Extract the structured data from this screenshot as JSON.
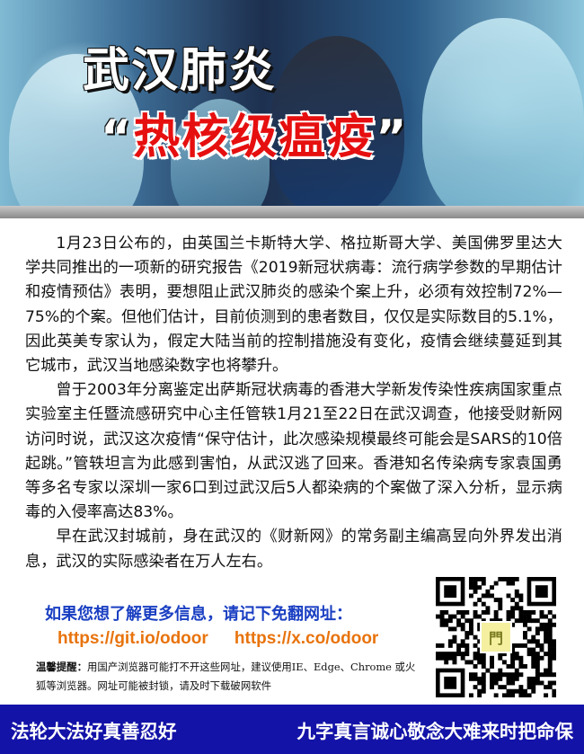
{
  "hero": {
    "title": "武汉肺炎",
    "subtitle_quote_open": "“",
    "subtitle": "热核级瘟疫",
    "subtitle_quote_close": "”"
  },
  "article": {
    "paragraphs": [
      "1月23日公布的，由英国兰卡斯特大学、格拉斯哥大学、美国佛罗里达大学共同推出的一项新的研究报告《2019新冠状病毒：流行病学参数的早期估计和疫情预估》表明，要想阻止武汉肺炎的感染个案上升，必须有效控制72%—75%的个案。但他们估计，目前侦测到的患者数目，仅仅是实际数目的5.1%，因此英美专家认为，假定大陆当前的控制措施没有变化，疫情会继续蔓延到其它城市，武汉当地感染数字也将攀升。",
      "曾于2003年分离鉴定出萨斯冠状病毒的香港大学新发传染性疾病国家重点实验室主任暨流感研究中心主任管轶1月21至22日在武汉调查，他接受财新网访问时说，武汉这次疫情“保守估计，此次感染规模最终可能会是SARS的10倍起跳。”管轶坦言为此感到害怕，从武汉逃了回来。香港知名传染病专家袁国勇等多名专家以深圳一家6口到过武汉后5人都染病的个案做了深入分析，显示病毒的入侵率高达83%。",
      "早在武汉封城前，身在武汉的《财新网》的常务副主编高昱向外界发出消息，武汉的实际感染者在万人左右。"
    ]
  },
  "info": {
    "headline": "如果您想了解更多信息，请记下免翻网址：",
    "urls": [
      "https://git.io/odoor",
      "https://x.co/odoor"
    ],
    "tip_label": "温馨提醒：",
    "tip_text": "用国产浏览器可能打不开这些网址，建议使用IE、Edge、Chrome 或火狐等浏览器。网址可能被封锁，请及时下载破网软件"
  },
  "qr": {
    "logo_text": "門"
  },
  "footer": {
    "left": "法轮大法好真善忍好",
    "right": "九字真言诚心敬念大难来时把命保"
  },
  "colors": {
    "info_blue": "#1a3fc2",
    "url_orange": "#e8730c",
    "title_red": "#e60f0f",
    "footer_blue": "#1313a8"
  }
}
